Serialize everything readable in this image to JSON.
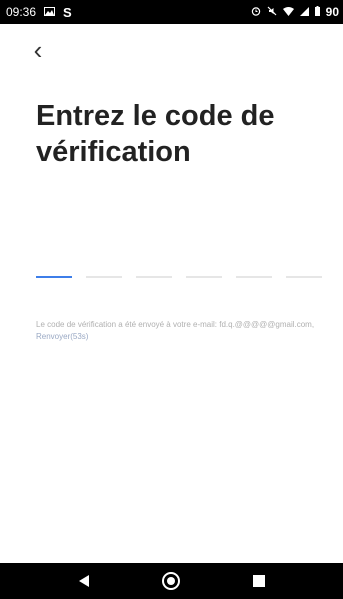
{
  "status_bar": {
    "time": "09:36",
    "carrier_letter": "S",
    "battery": "90"
  },
  "back_label": "‹",
  "title": "Entrez le code de vérification",
  "code_boxes": 6,
  "hint": {
    "text": "Le code de vérification a été envoyé à votre e-mail: ",
    "email": "fd.q.@@@@@gmail.com",
    "separator": ", ",
    "resend": "Renvoyer(53s)"
  },
  "colors": {
    "accent": "#3d7ee9",
    "inactive_line": "#e6e6e6",
    "status_bar": "#000000"
  },
  "icons": {
    "status": [
      "image-icon",
      "alarm-icon",
      "mute-icon",
      "wifi-icon",
      "signal-icon",
      "battery-icon"
    ],
    "nav": [
      "back-triangle-icon",
      "home-circle-icon",
      "recents-square-icon"
    ]
  }
}
